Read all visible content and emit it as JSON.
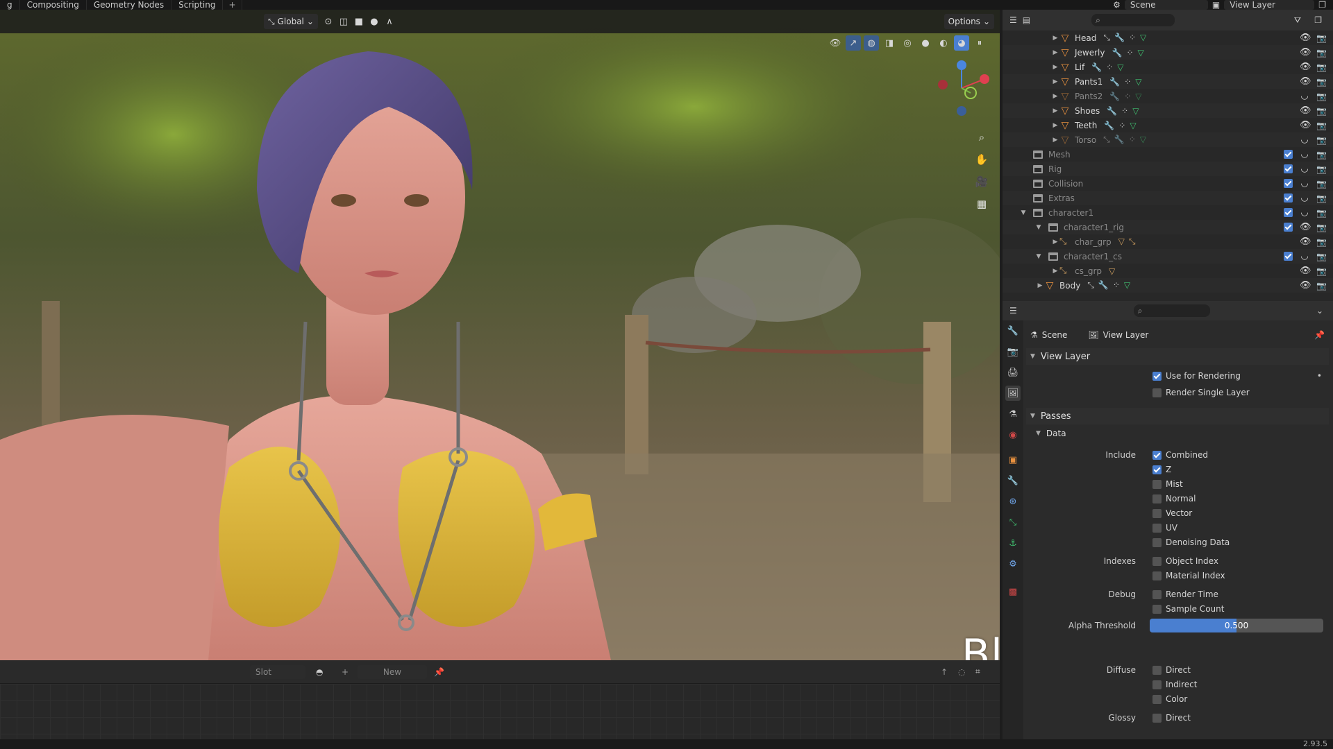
{
  "topbar": {
    "tabs": [
      "g",
      "Compositing",
      "Geometry Nodes",
      "Scripting",
      "+"
    ],
    "scene_label": "Scene",
    "view_layer_label": "View Layer"
  },
  "viewport": {
    "orientation_label": "Global",
    "options_label": "Options",
    "overlay_title": "Blender Project"
  },
  "lower_editor": {
    "slot_label": "Slot",
    "new_label": "New"
  },
  "outliner": {
    "rows": [
      {
        "name": "Head",
        "dim": false
      },
      {
        "name": "Jewerly",
        "dim": false
      },
      {
        "name": "Lif",
        "dim": false
      },
      {
        "name": "Pants1",
        "dim": false
      },
      {
        "name": "Pants2",
        "dim": true
      },
      {
        "name": "Shoes",
        "dim": false
      },
      {
        "name": "Teeth",
        "dim": false
      },
      {
        "name": "Torso",
        "dim": true
      },
      {
        "name": "Mesh",
        "dim": true
      },
      {
        "name": "Rig",
        "dim": true
      },
      {
        "name": "Collision",
        "dim": true
      },
      {
        "name": "Extras",
        "dim": true
      },
      {
        "name": "character1",
        "dim": true
      },
      {
        "name": "character1_rig",
        "dim": true
      },
      {
        "name": "char_grp",
        "dim": true
      },
      {
        "name": "character1_cs",
        "dim": true
      },
      {
        "name": "cs_grp",
        "dim": true
      },
      {
        "name": "Body",
        "dim": false
      }
    ]
  },
  "properties": {
    "breadcrumb": {
      "scene": "Scene",
      "view_layer": "View Layer"
    },
    "view_layer_panel": {
      "title": "View Layer",
      "use_for_rendering": "Use for Rendering",
      "render_single_layer": "Render Single Layer"
    },
    "passes_panel": {
      "title": "Passes",
      "data_title": "Data",
      "include_label": "Include",
      "combined": "Combined",
      "z": "Z",
      "mist": "Mist",
      "normal": "Normal",
      "vector": "Vector",
      "uv": "UV",
      "denoising_data": "Denoising Data",
      "indexes_label": "Indexes",
      "object_index": "Object Index",
      "material_index": "Material Index",
      "debug_label": "Debug",
      "render_time": "Render Time",
      "sample_count": "Sample Count",
      "alpha_threshold_label": "Alpha Threshold",
      "alpha_threshold_value": "0.500",
      "alpha_threshold_fraction": 0.5,
      "diffuse_label": "Diffuse",
      "direct": "Direct",
      "indirect": "Indirect",
      "color": "Color",
      "glossy_label": "Glossy",
      "glossy_direct": "Direct"
    }
  },
  "status": {
    "version": "2.93.5"
  },
  "colors": {
    "accent": "#4a7fd0",
    "mesh_orange": "#e8913f",
    "modifier_blue": "#6fa4e8",
    "data_green": "#40c070"
  }
}
